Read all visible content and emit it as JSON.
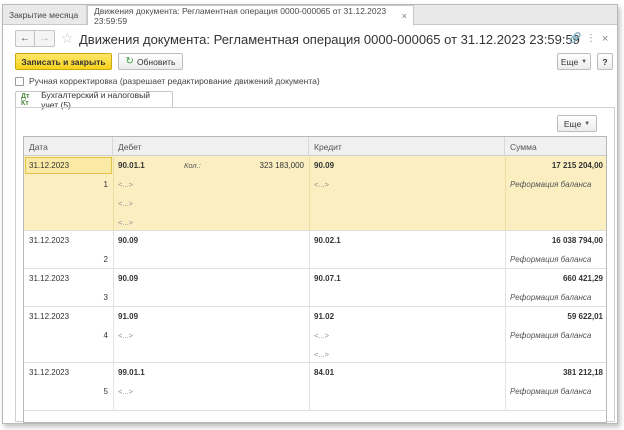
{
  "tabs": [
    {
      "label": "Закрытие месяца"
    },
    {
      "label": "Движения документа: Регламентная операция 0000-000065 от 31.12.2023 23:59:59",
      "close": "×"
    }
  ],
  "nav": {
    "back": "←",
    "forward": "→",
    "star": "☆"
  },
  "title": "Движения документа: Регламентная операция 0000-000065 от 31.12.2023 23:59:59",
  "title_icons": {
    "link": "🔗",
    "menu": "⋮",
    "close": "×"
  },
  "toolbar": {
    "save_close": "Записать и закрыть",
    "refresh_icon": "↻",
    "refresh": "Обновить",
    "more": "Еще",
    "help": "?"
  },
  "manual_edit": "Ручная корректировка (разрешает редактирование движений документа)",
  "subtab": {
    "icon": "Дт Кт",
    "label": "Бухгалтерский и налоговый учет (5)"
  },
  "table_toolbar": {
    "more": "Еще"
  },
  "table": {
    "headers": {
      "date": "Дата",
      "debit": "Дебет",
      "credit": "Кредит",
      "sum": "Сумма"
    },
    "rows": [
      {
        "date": "31.12.2023",
        "num": "1",
        "debit": "90.01.1",
        "qty_label": "Кол.:",
        "qty": "323 183,000",
        "credit": "90.09",
        "sum": "17 215 204,00",
        "desc": "Реформация баланса",
        "d_sub": [
          "<...>",
          "<...>",
          "<...>"
        ],
        "c_sub": [
          "<...>"
        ],
        "selected": true
      },
      {
        "date": "31.12.2023",
        "num": "2",
        "debit": "90.09",
        "credit": "90.02.1",
        "sum": "16 038 794,00",
        "desc": "Реформация баланса",
        "d_sub": [],
        "c_sub": [],
        "selected": false
      },
      {
        "date": "31.12.2023",
        "num": "3",
        "debit": "90.09",
        "credit": "90.07.1",
        "sum": "660 421,29",
        "desc": "Реформация баланса",
        "d_sub": [],
        "c_sub": [],
        "selected": false
      },
      {
        "date": "31.12.2023",
        "num": "4",
        "debit": "91.09",
        "credit": "91.02",
        "sum": "59 622,01",
        "desc": "Реформация баланса",
        "d_sub": [
          "<...>"
        ],
        "c_sub": [
          "<...>",
          "<...>"
        ],
        "selected": false
      },
      {
        "date": "31.12.2023",
        "num": "5",
        "debit": "99.01.1",
        "credit": "84.01",
        "sum": "381 212,18",
        "desc": "Реформация баланса",
        "d_sub": [
          "<...>"
        ],
        "c_sub": [],
        "selected": false
      }
    ]
  },
  "colors": {
    "accent": "#f7d21b",
    "selected_row": "#fbefc2"
  }
}
